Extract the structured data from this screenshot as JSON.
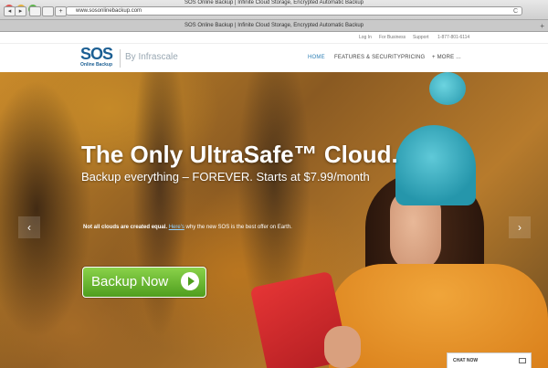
{
  "browser": {
    "window_title": "SOS Online Backup | Infinite Cloud Storage, Encrypted Automatic Backup",
    "url": "www.sosonlinebackup.com",
    "tab_title": "SOS Online Backup | Infinite Cloud Storage, Encrypted Automatic Backup",
    "back_glyph": "◂",
    "forward_glyph": "▸",
    "reload_glyph": "C",
    "new_tab_glyph": "+"
  },
  "utility_nav": {
    "login": "Log In",
    "for_business": "For Business",
    "support": "Support",
    "phone": "1-877-801-6114"
  },
  "brand": {
    "logo_text": "SOS",
    "logo_subtext": "Online Backup",
    "byline": "By Infrascale",
    "brand_color": "#1c5f93"
  },
  "main_nav": {
    "home": "HOME",
    "features": "FEATURES & SECURITY",
    "pricing": "PRICING",
    "more": "+ MORE ...",
    "active_color": "#2d7fb5"
  },
  "hero": {
    "headline": "The Only UltraSafe™ Cloud.",
    "subline": "Backup everything – FOREVER. Starts at $7.99/month",
    "tagline_bold": "Not all clouds are created equal.",
    "tagline_link": "Here's",
    "tagline_rest": "why the new SOS is the best offer on Earth.",
    "cta_label": "Backup Now",
    "prev_arrow": "‹",
    "next_arrow": "›"
  },
  "chat": {
    "label": "CHAT NOW"
  }
}
